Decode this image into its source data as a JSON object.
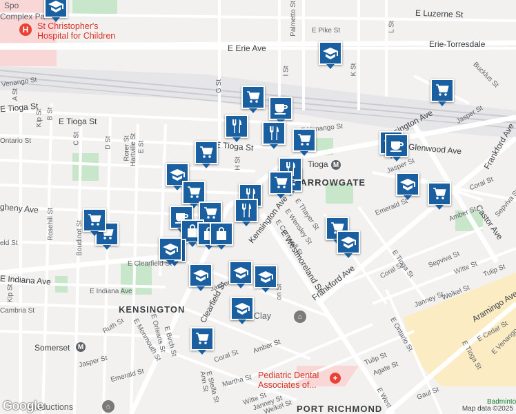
{
  "map": {
    "attribution": "Map data ©2025",
    "logo": "Google",
    "colors": {
      "background": "#f2f1ef",
      "road": "#ffffff",
      "park": "#c8e6c9",
      "hospital": "#f8d7d6",
      "commercial": "#fbecc4",
      "rail": "#c9cbcf",
      "marker": "#1a5fa0"
    }
  },
  "street_labels": [
    {
      "name": "E Luzerne St",
      "style": "big"
    },
    {
      "name": "E Pike St",
      "style": ""
    },
    {
      "name": "L St",
      "style": ""
    },
    {
      "name": "Palmetto St",
      "style": ""
    },
    {
      "name": "E Erie Ave",
      "style": "big"
    },
    {
      "name": "Erie-Torresdale",
      "style": "big"
    },
    {
      "name": "K St",
      "style": ""
    },
    {
      "name": "I St",
      "style": ""
    },
    {
      "name": "G St",
      "style": ""
    },
    {
      "name": "Bucklus St",
      "style": ""
    },
    {
      "name": "Venango St",
      "style": ""
    },
    {
      "name": "E Tioga St",
      "style": "big"
    },
    {
      "name": "A St",
      "style": ""
    },
    {
      "name": "Kip St",
      "style": ""
    },
    {
      "name": "B St",
      "style": ""
    },
    {
      "name": "E Tioga St",
      "style": "big"
    },
    {
      "name": "E Venango St",
      "style": ""
    },
    {
      "name": "Kensington Ave",
      "style": "big"
    },
    {
      "name": "Jasper St",
      "style": ""
    },
    {
      "name": "Glenwood Ave",
      "style": "big"
    },
    {
      "name": "Frankford Ave",
      "style": "big"
    },
    {
      "name": "Ontario St",
      "style": ""
    },
    {
      "name": "C St",
      "style": ""
    },
    {
      "name": "D St",
      "style": ""
    },
    {
      "name": "Rorer St",
      "style": ""
    },
    {
      "name": "Hartville St",
      "style": ""
    },
    {
      "name": "E St",
      "style": ""
    },
    {
      "name": "E Tioga St",
      "style": ""
    },
    {
      "name": "H St",
      "style": ""
    },
    {
      "name": "Tioga",
      "style": "big"
    },
    {
      "name": "HARROWGATE",
      "style": "area"
    },
    {
      "name": "Jasper St",
      "style": ""
    },
    {
      "name": "Coral St",
      "style": ""
    },
    {
      "name": "Sepviva St",
      "style": ""
    },
    {
      "name": "Castor Ave",
      "style": "big"
    },
    {
      "name": "gheny Ave",
      "style": "big"
    },
    {
      "name": "Rosehill St",
      "style": ""
    },
    {
      "name": "Emerald St",
      "style": ""
    },
    {
      "name": "Amber St",
      "style": ""
    },
    {
      "name": "Kensington Ave",
      "style": "big"
    },
    {
      "name": "E Thayer St",
      "style": ""
    },
    {
      "name": "E Wensley St",
      "style": ""
    },
    {
      "name": "E Cornwall St",
      "style": ""
    },
    {
      "name": "E Westmoreland St",
      "style": "big"
    },
    {
      "name": "eld St",
      "style": ""
    },
    {
      "name": "Boudinot St",
      "style": ""
    },
    {
      "name": "E Clearfield St",
      "style": ""
    },
    {
      "name": "E Indiana Ave",
      "style": "big"
    },
    {
      "name": "E Indiana Ave",
      "style": ""
    },
    {
      "name": "Kip St",
      "style": ""
    },
    {
      "name": "Clearfield St",
      "style": "big"
    },
    {
      "name": "Jasper St",
      "style": ""
    },
    {
      "name": "Frankford Ave",
      "style": "big"
    },
    {
      "name": "Coral St",
      "style": ""
    },
    {
      "name": "E Tioga St",
      "style": ""
    },
    {
      "name": "Sepviva St",
      "style": ""
    },
    {
      "name": "Witte St",
      "style": ""
    },
    {
      "name": "Tulip St",
      "style": ""
    },
    {
      "name": "Janney St",
      "style": ""
    },
    {
      "name": "Weikel St",
      "style": ""
    },
    {
      "name": "Aramingo Ave",
      "style": "big"
    },
    {
      "name": "KENSINGTON",
      "style": "area"
    },
    {
      "name": "Cambria St",
      "style": ""
    },
    {
      "name": "Ruth St",
      "style": ""
    },
    {
      "name": "E Monmouth St",
      "style": ""
    },
    {
      "name": "E Orleans St",
      "style": ""
    },
    {
      "name": "E Birch St",
      "style": ""
    },
    {
      "name": "Somerset",
      "style": "big"
    },
    {
      "name": "Jasper St",
      "style": ""
    },
    {
      "name": "Emerald St",
      "style": ""
    },
    {
      "name": "Coral St",
      "style": ""
    },
    {
      "name": "Amber St",
      "style": ""
    },
    {
      "name": "E Ontario St",
      "style": ""
    },
    {
      "name": "Tulip St",
      "style": ""
    },
    {
      "name": "Agate St",
      "style": ""
    },
    {
      "name": "E Tioga St",
      "style": ""
    },
    {
      "name": "E Cedar St",
      "style": ""
    },
    {
      "name": "E Venango St",
      "style": ""
    },
    {
      "name": "Ann St",
      "style": ""
    },
    {
      "name": "E Stella St",
      "style": ""
    },
    {
      "name": "Martha St",
      "style": ""
    },
    {
      "name": "Witte St",
      "style": ""
    },
    {
      "name": "Janney St",
      "style": ""
    },
    {
      "name": "Weikel St",
      "style": ""
    },
    {
      "name": "PORT RICHMOND",
      "style": "area"
    },
    {
      "name": "Gaul St",
      "style": ""
    },
    {
      "name": "Badminton",
      "style": ""
    },
    {
      "name": "E West",
      "style": ""
    },
    {
      "name": "Complex Pa",
      "style": "big"
    },
    {
      "name": "Spo",
      "style": "big"
    },
    {
      "name": "on St",
      "style": ""
    },
    {
      "name": "Way Clay",
      "style": "big"
    }
  ],
  "places": {
    "hospital": "St Christopher's Hospital for Children",
    "hospital_line1": "St Christopher's",
    "hospital_line2": "Hospital for Children",
    "dental_line1": "Pediatric Dental",
    "dental_line2": "Associates of...",
    "productions": "Productions"
  },
  "markers": [
    {
      "type": "school"
    },
    {
      "type": "school"
    },
    {
      "type": "cart"
    },
    {
      "type": "cup"
    },
    {
      "type": "cart"
    },
    {
      "type": "fork"
    },
    {
      "type": "fork"
    },
    {
      "type": "cart"
    },
    {
      "type": "school"
    },
    {
      "type": "cup"
    },
    {
      "type": "school"
    },
    {
      "type": "cart"
    },
    {
      "type": "cart"
    },
    {
      "type": "fork"
    },
    {
      "type": "cart"
    },
    {
      "type": "school"
    },
    {
      "type": "cart"
    },
    {
      "type": "cart"
    },
    {
      "type": "fork"
    },
    {
      "type": "cart"
    },
    {
      "type": "fork"
    },
    {
      "type": "cup"
    },
    {
      "type": "cart"
    },
    {
      "type": "school"
    },
    {
      "type": "cart"
    },
    {
      "type": "bag"
    },
    {
      "type": "bag"
    },
    {
      "type": "bag"
    },
    {
      "type": "bag"
    },
    {
      "type": "school"
    },
    {
      "type": "school"
    },
    {
      "type": "school"
    },
    {
      "type": "school"
    },
    {
      "type": "cart"
    },
    {
      "type": "cart"
    },
    {
      "type": "school"
    }
  ]
}
